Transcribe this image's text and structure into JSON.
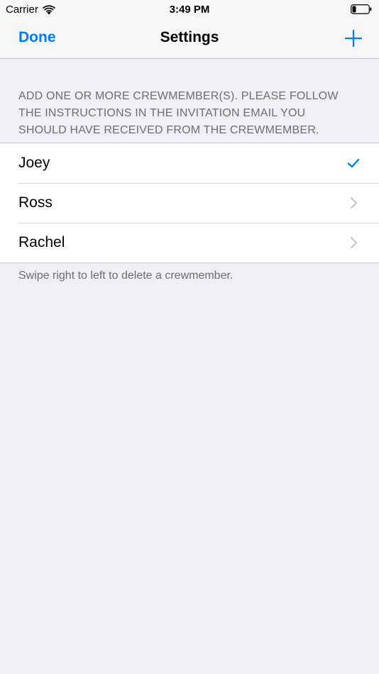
{
  "status_bar": {
    "carrier": "Carrier",
    "time": "3:49 PM",
    "wifi_icon": "wifi-icon",
    "battery_icon": "battery-icon"
  },
  "nav": {
    "done_label": "Done",
    "title": "Settings",
    "add_icon": "plus-icon",
    "accent_color": "#007aff"
  },
  "section": {
    "header": "ADD ONE OR MORE CREWMEMBER(S). PLEASE FOLLOW THE INSTRUCTIONS IN THE INVITATION EMAIL YOU SHOULD HAVE RECEIVED FROM THE CREWMEMBER.",
    "footer": "Swipe right to left to delete a crewmember."
  },
  "crewmembers": [
    {
      "name": "Joey",
      "accessory": "checkmark-icon"
    },
    {
      "name": "Ross",
      "accessory": "chevron-right-icon"
    },
    {
      "name": "Rachel",
      "accessory": "chevron-right-icon"
    }
  ]
}
